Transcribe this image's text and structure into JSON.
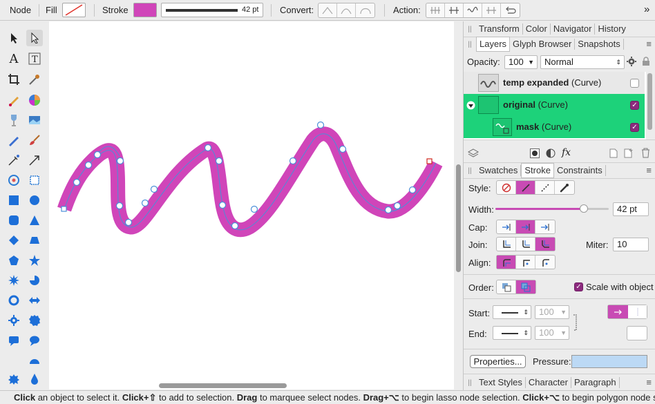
{
  "toolbar": {
    "context_label": "Node",
    "fill_label": "Fill",
    "stroke_label": "Stroke",
    "stroke_width": "42 pt",
    "convert_label": "Convert:",
    "action_label": "Action:",
    "overflow": "»"
  },
  "colors": {
    "stroke": "#d045b9",
    "accent_green": "#1dd27a",
    "check_purple": "#8c2a7e",
    "seg_active": "#c84bb4"
  },
  "panel_top": {
    "tabs": [
      "Transform",
      "Color",
      "Navigator",
      "History"
    ]
  },
  "layers_panel": {
    "tabs": [
      "Layers",
      "Glyph Browser",
      "Snapshots"
    ],
    "opacity_label": "Opacity:",
    "opacity_value": "100",
    "blend_mode": "Normal",
    "rows": [
      {
        "name": "temp expanded",
        "type": "(Curve)",
        "checked": false
      },
      {
        "name": "original",
        "type": "(Curve)",
        "checked": true
      },
      {
        "name": "mask",
        "type": "(Curve)",
        "checked": true
      }
    ]
  },
  "stroke_panel": {
    "tabs": [
      "Swatches",
      "Stroke",
      "Constraints"
    ],
    "style_label": "Style:",
    "width_label": "Width:",
    "width_value": "42 pt",
    "width_fraction": 0.78,
    "cap_label": "Cap:",
    "join_label": "Join:",
    "miter_label": "Miter:",
    "miter_value": "10",
    "align_label": "Align:",
    "order_label": "Order:",
    "scale_label": "Scale with object",
    "start_label": "Start:",
    "end_label": "End:",
    "start_size": "100",
    "end_size": "100",
    "properties_btn": "Properties...",
    "pressure_label": "Pressure:"
  },
  "panel_bottom": {
    "tabs": [
      "Text Styles",
      "Character",
      "Paragraph"
    ]
  },
  "status": {
    "parts": [
      {
        "b": "Click",
        "t": " an object to select it. "
      },
      {
        "b": "Click+⇧",
        "t": " to add to selection. "
      },
      {
        "b": "Drag",
        "t": " to marquee select nodes. "
      },
      {
        "b": "Drag+⌥",
        "t": " to begin lasso node selection. "
      },
      {
        "b": "Click+⌥",
        "t": " to begin polygon node selection."
      }
    ]
  }
}
